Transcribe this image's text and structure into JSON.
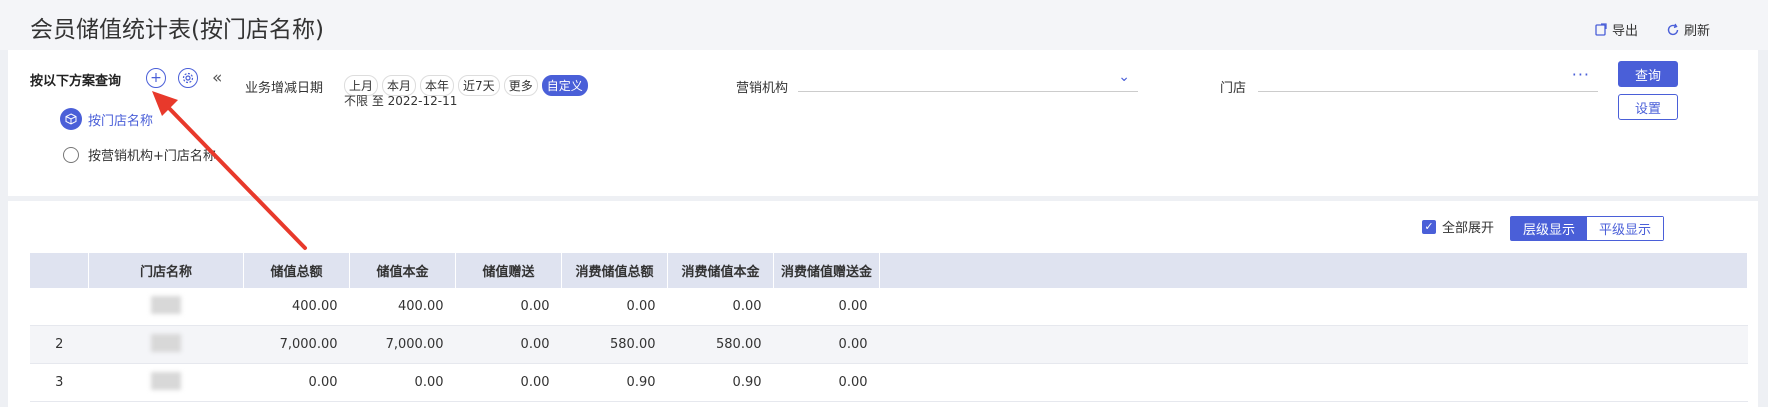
{
  "header": {
    "title": "会员储值统计表(按门店名称)",
    "export_label": "导出",
    "refresh_label": "刷新"
  },
  "scheme": {
    "title": "按以下方案查询",
    "items": [
      {
        "label": "按门店名称",
        "active": true
      },
      {
        "label": "按营销机构+门店名称",
        "active": false
      }
    ]
  },
  "filters": {
    "date_label": "业务增减日期",
    "date_chips": [
      "上月",
      "本月",
      "本年",
      "近7天",
      "更多",
      "自定义"
    ],
    "date_active": "自定义",
    "date_range": "不限 至 2022-12-11",
    "org_label": "营销机构",
    "org_value": "",
    "store_label": "门店",
    "store_value": "",
    "query_label": "查询",
    "setting_label": "设置"
  },
  "table_toolbar": {
    "expand_all_label": "全部展开",
    "expand_all_checked": true,
    "view_modes": [
      "层级显示",
      "平级显示"
    ],
    "view_active": "层级显示"
  },
  "table": {
    "columns": [
      "",
      "门店名称",
      "储值总额",
      "储值本金",
      "储值赠送",
      "消费储值总额",
      "消费储值本金",
      "消费储值赠送金"
    ],
    "rows": [
      {
        "index": "",
        "name": "",
        "values": [
          "400.00",
          "400.00",
          "0.00",
          "0.00",
          "0.00",
          "0.00"
        ]
      },
      {
        "index": "2",
        "name": "",
        "values": [
          "7,000.00",
          "7,000.00",
          "0.00",
          "580.00",
          "580.00",
          "0.00"
        ]
      },
      {
        "index": "3",
        "name": "",
        "values": [
          "0.00",
          "0.00",
          "0.00",
          "0.90",
          "0.90",
          "0.00"
        ]
      }
    ]
  },
  "colors": {
    "accent": "#4a5fd8",
    "annotation_arrow": "#e8392b"
  },
  "icons": [
    "export-icon",
    "refresh-icon",
    "add-icon",
    "gear-icon",
    "collapse-icon",
    "cube-icon",
    "clock-icon",
    "chevron-down-icon",
    "more-icon",
    "check-icon"
  ]
}
